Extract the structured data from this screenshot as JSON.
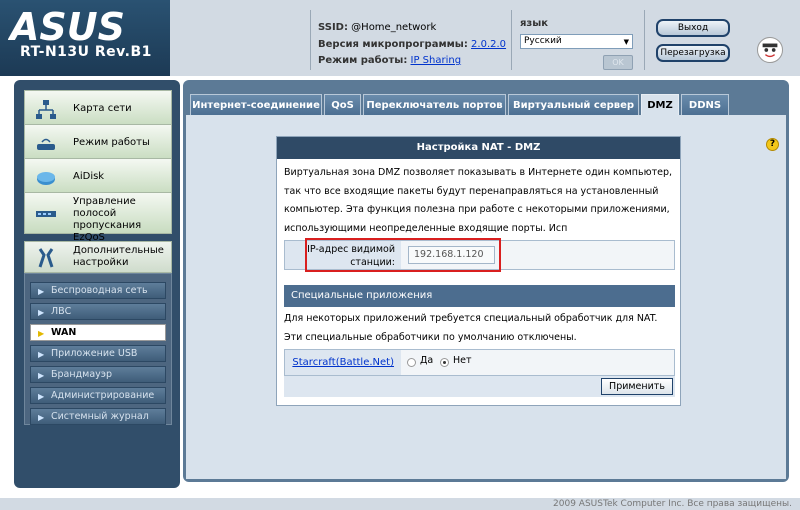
{
  "header": {
    "logo_text": "ASUS",
    "model": "RT-N13U Rev.B1",
    "ssid_label": "SSID:",
    "ssid_value": "@Home_network",
    "firmware_label": "Версия микропрограммы:",
    "firmware_value": "2.0.2.0",
    "mode_label": "Режим работы:",
    "mode_value": "IP Sharing",
    "language_label": "язык",
    "language_value": "Русский",
    "ok_label": "OK",
    "logout_label": "Выход",
    "reboot_label": "Перезагрузка"
  },
  "sidebar": {
    "main_items": [
      {
        "label": "Карта сети",
        "icon": "network-map-icon"
      },
      {
        "label": "Режим работы",
        "icon": "router-icon"
      },
      {
        "label": "AiDisk",
        "icon": "aidisk-icon"
      },
      {
        "label": "Управление полосой пропускания EzQoS",
        "icon": "qos-icon"
      },
      {
        "label": "Дополнительные настройки",
        "icon": "tools-icon"
      }
    ],
    "sub_items": [
      {
        "label": "Беспроводная сеть"
      },
      {
        "label": "ЛВС"
      },
      {
        "label": "WAN"
      },
      {
        "label": "Приложение USB"
      },
      {
        "label": "Брандмауэр"
      },
      {
        "label": "Администрирование"
      },
      {
        "label": "Системный журнал"
      }
    ],
    "active_sub": "WAN"
  },
  "tabs": [
    {
      "label": "Интернет-соединение"
    },
    {
      "label": "QoS"
    },
    {
      "label": "Переключатель портов"
    },
    {
      "label": "Виртуальный сервер"
    },
    {
      "label": "DMZ"
    },
    {
      "label": "DDNS"
    }
  ],
  "active_tab": "DMZ",
  "panel": {
    "title": "Настройка NAT - DMZ",
    "description": "Виртуальная зона DMZ позволяет показывать в Интернете один компьютер, так что все входящие пакеты будут перенаправляться на установленный компьютер. Эта функция полезна при работе с некоторыми приложениями, использующими неопределенные входящие порты. Исп",
    "ip_label": "IP-адрес видимой станции:",
    "ip_value": "192.168.1.120",
    "special_header": "Специальные приложения",
    "special_desc": "Для некоторых приложений требуется специальный обработчик для NAT. Эти специальные обработчики по умолчанию отключены.",
    "starcraft_label": "Starcraft(Battle.Net)",
    "radio_yes": "Да",
    "radio_no": "Нет",
    "radio_selected": "Нет",
    "apply_label": "Применить"
  },
  "help_glyph": "?",
  "footer": "2009 ASUSTek Computer Inc. Все права защищены.",
  "colors": {
    "header_bg": "#d2dae3",
    "logo_panel": "#1a3650",
    "content_frame": "#5c7a96",
    "panel_header": "#2f4a66",
    "highlight": "#d91f1f"
  }
}
